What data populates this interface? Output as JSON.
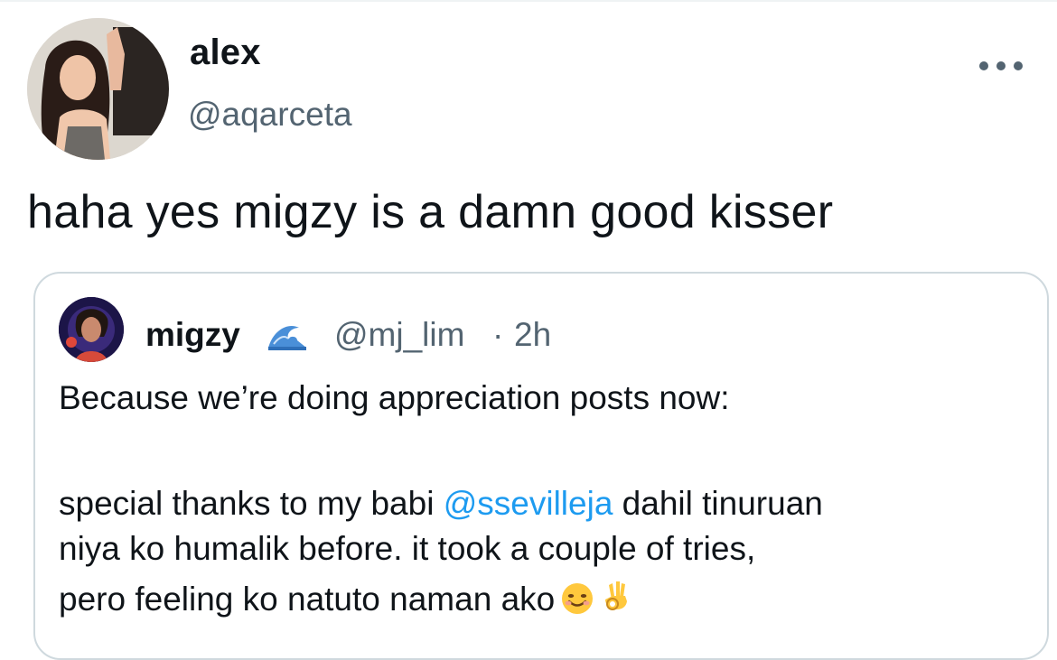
{
  "tweet": {
    "author": {
      "display_name": "alex",
      "handle": "@aqarceta"
    },
    "text": "haha yes migzy is a damn good kisser",
    "more_icon": "more-dots-icon"
  },
  "quote": {
    "author": {
      "display_name": "migzy",
      "badge_icon": "wave-emoji",
      "handle": "@mj_lim",
      "separator": "·",
      "time": "2h"
    },
    "line1": "Because we’re doing appreciation posts now:",
    "line3_pre": "special thanks to my babi ",
    "mention": "@ssevilleja",
    "line3_post": " dahil tinuruan",
    "line4": "niya ko humalik before. it took a couple of tries,",
    "line5": "pero feeling ko natuto naman ako",
    "emojis": [
      "smiling-face-emoji",
      "ok-hand-emoji"
    ]
  },
  "colors": {
    "text": "#0f1419",
    "secondary": "#536471",
    "link": "#1d9bf0",
    "border": "#cfd9de"
  }
}
